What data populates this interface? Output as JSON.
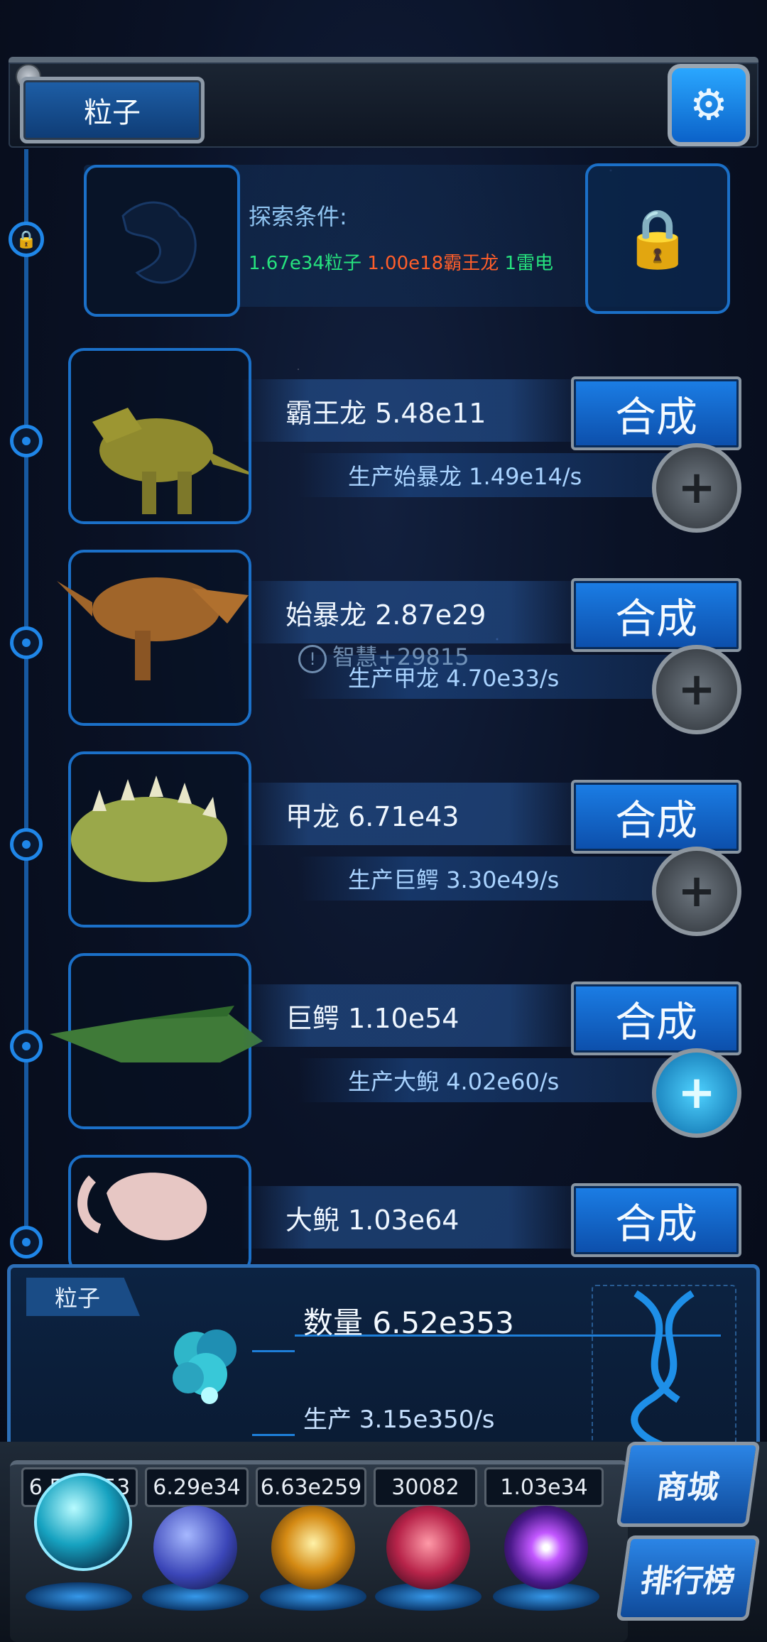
{
  "header": {
    "title": "粒子",
    "settings_icon": "gear-icon"
  },
  "explore": {
    "title": "探索条件:",
    "cond1": "1.67e34粒子",
    "cond2": "1.00e18霸王龙",
    "cond3": "1雷电",
    "lock_icon": "lock-icon",
    "silhouette_icon": "dragon-silhouette-icon"
  },
  "creatures": [
    {
      "name": "霸王龙 5.48e11",
      "synth": "合成",
      "prod": "生产始暴龙 1.49e14/s",
      "plus_active": false
    },
    {
      "name": "始暴龙 2.87e29",
      "synth": "合成",
      "prod": "生产甲龙 4.70e33/s",
      "plus_active": false
    },
    {
      "name": "甲龙 6.71e43",
      "synth": "合成",
      "prod": "生产巨鳄 3.30e49/s",
      "plus_active": false
    },
    {
      "name": "巨鳄 1.10e54",
      "synth": "合成",
      "prod": "生产大鲵 4.02e60/s",
      "plus_active": true
    },
    {
      "name": "大鲵 1.03e64",
      "synth": "合成"
    }
  ],
  "toast": "智慧+29815",
  "info": {
    "tag": "粒子",
    "count": "数量 6.52e353",
    "production": "生产 3.15e350/s"
  },
  "dock": {
    "values": [
      "6.52e353",
      "6.29e34",
      "6.63e259",
      "30082",
      "1.03e34"
    ],
    "shop": "商城",
    "rank": "排行榜"
  },
  "colors": {
    "accent": "#1f86e8",
    "green": "#26e27e",
    "orange": "#ff5e2a"
  }
}
